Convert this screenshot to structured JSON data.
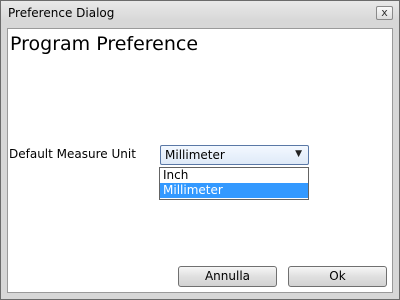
{
  "window": {
    "title": "Preference Dialog",
    "close_glyph": "x"
  },
  "main": {
    "heading": "Program Preference",
    "measure_label": "Default Measure Unit",
    "measure_select": {
      "value": "Millimeter",
      "options": [
        "Inch",
        "Millimeter"
      ],
      "selected_index": 1
    }
  },
  "footer": {
    "cancel_label": "Annulla",
    "ok_label": "Ok"
  }
}
